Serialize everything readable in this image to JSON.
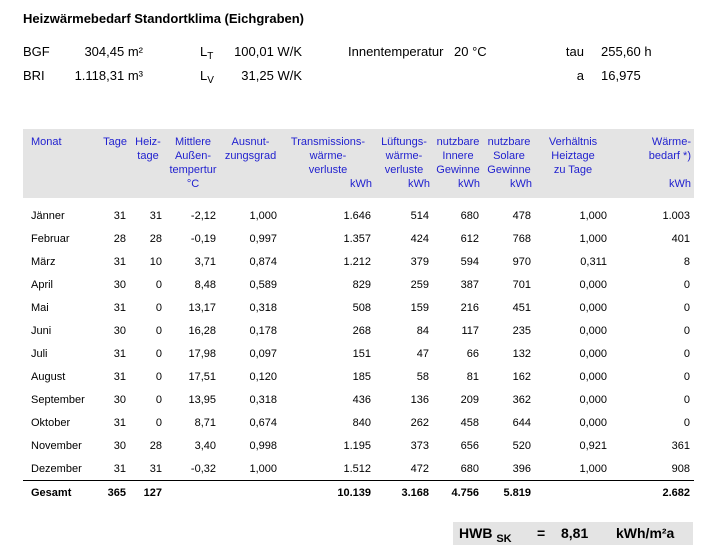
{
  "title": "Heizwärmebedarf Standortklima  (Eichgraben)",
  "params": {
    "bgf_label": "BGF",
    "bgf_value": "304,45 m²",
    "bri_label": "BRI",
    "bri_value": "1.118,31 m³",
    "lt_label": "L",
    "lt_sub": "T",
    "lt_value": "100,01 W/K",
    "lv_label": "L",
    "lv_sub": "V",
    "lv_value": "31,25 W/K",
    "innen_label": "Innentemperatur",
    "innen_value": "20 °C",
    "tau_label": "tau",
    "tau_value": "255,60 h",
    "a_label": "a",
    "a_value": "16,975"
  },
  "table": {
    "headers": [
      "Monat",
      "Tage",
      "Heiz-\ntage",
      "Mittlere\nAußen-\ntempertur",
      "Ausnut-\nzungsgrad",
      "Transmissions-\nwärme-\nverluste",
      "Lüftungs-\nwärme-\nverluste",
      "nutzbare\nInnere\nGewinne",
      "nutzbare\nSolare\nGewinne",
      "Verhältnis\nHeiztage\nzu Tage",
      "Wärme-\nbedarf *)"
    ],
    "units": [
      "",
      "",
      "",
      "°C",
      "",
      "kWh",
      "kWh",
      "kWh",
      "kWh",
      "",
      "kWh"
    ],
    "rows": [
      [
        "Jänner",
        "31",
        "31",
        "-2,12",
        "1,000",
        "1.646",
        "514",
        "680",
        "478",
        "1,000",
        "1.003"
      ],
      [
        "Februar",
        "28",
        "28",
        "-0,19",
        "0,997",
        "1.357",
        "424",
        "612",
        "768",
        "1,000",
        "401"
      ],
      [
        "März",
        "31",
        "10",
        "3,71",
        "0,874",
        "1.212",
        "379",
        "594",
        "970",
        "0,311",
        "8"
      ],
      [
        "April",
        "30",
        "0",
        "8,48",
        "0,589",
        "829",
        "259",
        "387",
        "701",
        "0,000",
        "0"
      ],
      [
        "Mai",
        "31",
        "0",
        "13,17",
        "0,318",
        "508",
        "159",
        "216",
        "451",
        "0,000",
        "0"
      ],
      [
        "Juni",
        "30",
        "0",
        "16,28",
        "0,178",
        "268",
        "84",
        "117",
        "235",
        "0,000",
        "0"
      ],
      [
        "Juli",
        "31",
        "0",
        "17,98",
        "0,097",
        "151",
        "47",
        "66",
        "132",
        "0,000",
        "0"
      ],
      [
        "August",
        "31",
        "0",
        "17,51",
        "0,120",
        "185",
        "58",
        "81",
        "162",
        "0,000",
        "0"
      ],
      [
        "September",
        "30",
        "0",
        "13,95",
        "0,318",
        "436",
        "136",
        "209",
        "362",
        "0,000",
        "0"
      ],
      [
        "Oktober",
        "31",
        "0",
        "8,71",
        "0,674",
        "840",
        "262",
        "458",
        "644",
        "0,000",
        "0"
      ],
      [
        "November",
        "30",
        "28",
        "3,40",
        "0,998",
        "1.195",
        "373",
        "656",
        "520",
        "0,921",
        "361"
      ],
      [
        "Dezember",
        "31",
        "31",
        "-0,32",
        "1,000",
        "1.512",
        "472",
        "680",
        "396",
        "1,000",
        "908"
      ]
    ],
    "total": [
      "Gesamt",
      "365",
      "127",
      "",
      "",
      "10.139",
      "3.168",
      "4.756",
      "5.819",
      "",
      "2.682"
    ]
  },
  "hwb": {
    "label": "HWB",
    "sub": "SK",
    "eq": "=",
    "value": "8,81",
    "unit": "kWh/m²a"
  }
}
